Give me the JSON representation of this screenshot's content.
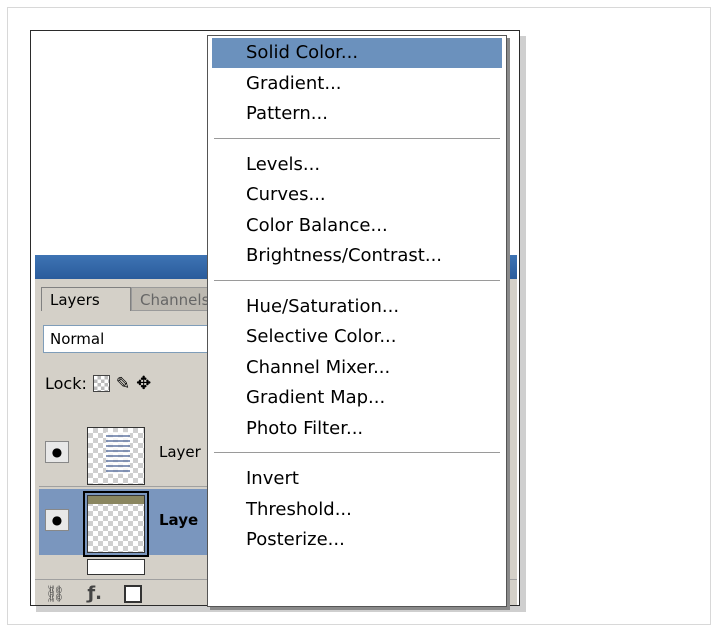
{
  "layers_panel": {
    "tabs": [
      {
        "label": "Layers",
        "active": true
      },
      {
        "label": "Channels",
        "active": false
      }
    ],
    "blend_mode": "Normal",
    "lock_label": "Lock:",
    "layers": [
      {
        "name": "Layer",
        "selected": false
      },
      {
        "name": "Laye",
        "selected": true
      }
    ]
  },
  "adjustment_menu": {
    "highlight_color": "#6b91bd",
    "groups": [
      [
        "Solid Color...",
        "Gradient...",
        "Pattern..."
      ],
      [
        "Levels...",
        "Curves...",
        "Color Balance...",
        "Brightness/Contrast..."
      ],
      [
        "Hue/Saturation...",
        "Selective Color...",
        "Channel Mixer...",
        "Gradient Map...",
        "Photo Filter..."
      ],
      [
        "Invert",
        "Threshold...",
        "Posterize..."
      ]
    ],
    "highlighted_item": "Solid Color..."
  }
}
